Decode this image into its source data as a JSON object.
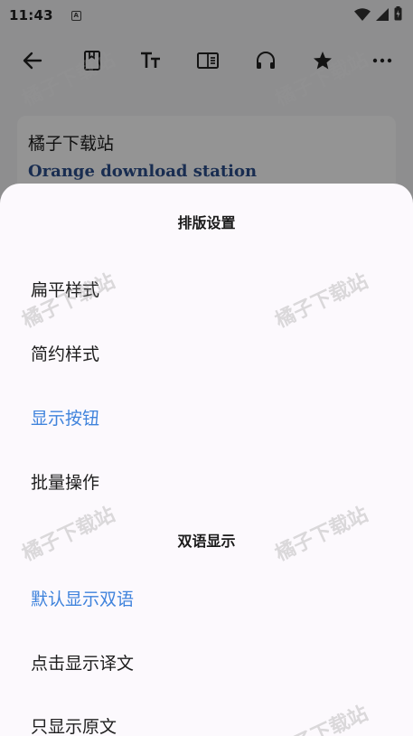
{
  "status_bar": {
    "time": "11:43",
    "notification_letter": "A"
  },
  "toolbar": {
    "icons": [
      "back-arrow-icon",
      "bookmark-page-icon",
      "text-size-icon",
      "reader-mode-icon",
      "headphones-icon",
      "star-icon",
      "more-icon"
    ]
  },
  "card": {
    "title": "橘子下载站",
    "subtitle": "Orange download station"
  },
  "sheet": {
    "layout_header": "排版设置",
    "layout_items": [
      {
        "label": "扁平样式",
        "selected": false
      },
      {
        "label": "简约样式",
        "selected": false
      },
      {
        "label": "显示按钮",
        "selected": true
      },
      {
        "label": "批量操作",
        "selected": false
      }
    ],
    "bilingual_header": "双语显示",
    "bilingual_items": [
      {
        "label": "默认显示双语",
        "selected": true
      },
      {
        "label": "点击显示译文",
        "selected": false
      },
      {
        "label": "只显示原文",
        "selected": false
      }
    ]
  },
  "watermark": "橘子下载站",
  "colors": {
    "accent": "#3f83dc",
    "subtitle": "#2b4f8c",
    "sheet_bg": "#fcf9fd"
  }
}
